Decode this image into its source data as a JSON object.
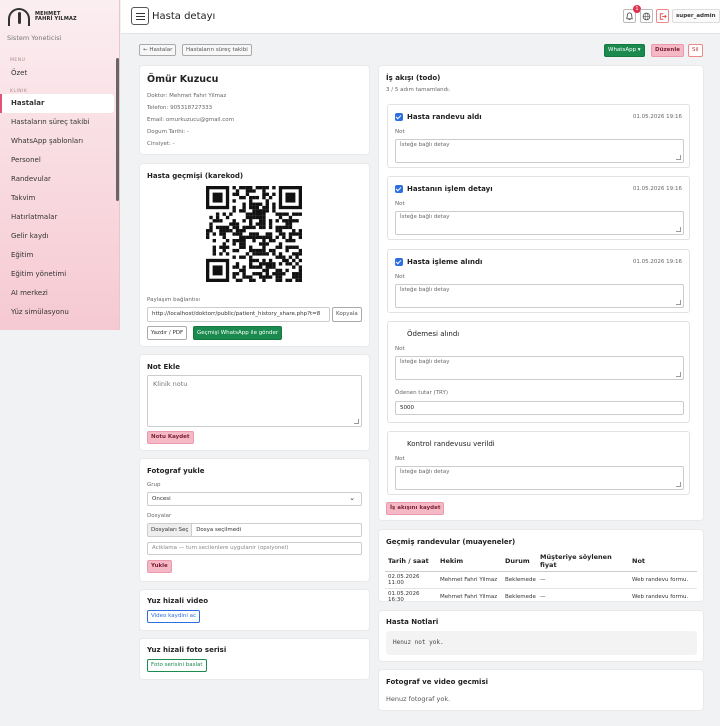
{
  "brand": {
    "line1": "MEHMET",
    "line2": "FAHRİ YILMAZ",
    "role": "Sistem Yoneticisi"
  },
  "sidebar": {
    "menu_head": "MENU",
    "overview": "Özet",
    "clinic_head": "KLINIK",
    "items": [
      "Hastalar",
      "Hastaların süreç takibi",
      "WhatsApp şablonları",
      "Personel",
      "Randevular",
      "Takvim",
      "Hatırlatmalar",
      "Gelir kaydı",
      "Eğitim",
      "Eğitim yönetimi",
      "AI merkezi",
      "Yüz simülasyonu"
    ]
  },
  "topbar": {
    "title": "Hasta detayı",
    "notif_count": "1",
    "user": "super_admin",
    "bell": "bell-icon",
    "globe": "globe-icon",
    "logout": "logout-icon"
  },
  "actions": {
    "back": "← Hastalar",
    "process": "Hastaların süreç takibi",
    "whatsapp": "WhatsApp ▾",
    "edit": "Düzenle",
    "delete": "Sil"
  },
  "patient": {
    "name": "Ömür Kuzucu",
    "doctor": "Doktor: Mehmet Fahri Yilmaz",
    "phone": "Telefon: 905318727333",
    "email": "Email: omurkuzucu@gmail.com",
    "birth": "Dogum Tarihi: -",
    "gender": "Cinsiyet: -"
  },
  "history": {
    "title": "Hasta geçmişi (karekod)",
    "share_label": "Paylaşım bağlantısı",
    "share_link": "http://localhost/doktorr/public/patient_history_share.php?t=8",
    "copy": "Kopyala",
    "print": "Yazdır / PDF",
    "send": "Geçmişi WhatsApp ile gönder"
  },
  "note": {
    "title": "Not Ekle",
    "placeholder": "Klinik notu",
    "save": "Notu Kaydet"
  },
  "photo": {
    "title": "Fotograf yukle",
    "group_label": "Grup",
    "group_value": "Oncesi",
    "files_label": "Dosyalar",
    "choose": "Dosyaları Seç",
    "no_file": "Dosya seçilmedi",
    "desc_placeholder": "Aciklama — tum secilenlere uygulanir (opsiyonel)",
    "upload": "Yukle"
  },
  "video": {
    "title": "Yuz hizali video",
    "button": "Video kaydini ac"
  },
  "series": {
    "title": "Yuz hizali foto serisi",
    "button": "Foto serisini baslat"
  },
  "workflow": {
    "title": "İş akışı (todo)",
    "summary": "3 / 5 adım tamamlandı.",
    "note_label": "Not",
    "note_placeholder": "İsteğe bağlı detay",
    "tasks": [
      {
        "label": "Hasta randevu aldı",
        "date": "01.05.2026 19:16"
      },
      {
        "label": "Hastanın işlem detayı",
        "date": "01.05.2026 19:16"
      },
      {
        "label": "Hasta işleme alındı",
        "date": "01.05.2026 19:16"
      },
      {
        "label": "Ödemesi alındı",
        "date": ""
      },
      {
        "label": "Kontrol randevusu verildi",
        "date": ""
      }
    ],
    "paid_label": "Ödenen tutar (TRY)",
    "paid_value": "5000",
    "save": "İş akışını kaydet"
  },
  "appointments": {
    "title": "Geçmiş randevular (muayeneler)",
    "headers": [
      "Tarih / saat",
      "Hekim",
      "Durum",
      "Müşteriye söylenen fiyat",
      "Not"
    ],
    "rows": [
      [
        "02.05.2026 11:00",
        "Mehmet Fahri Yilmaz",
        "Beklemede",
        "—",
        "Web randevu formu."
      ],
      [
        "01.05.2026 16:30",
        "Mehmet Fahri Yilmaz",
        "Beklemede",
        "—",
        "Web randevu formu."
      ]
    ]
  },
  "notes_panel": {
    "title": "Hasta Notlari",
    "empty": "Henuz not yok."
  },
  "media_panel": {
    "title": "Fotograf ve video gecmisi",
    "empty": "Henuz fotograf yok."
  }
}
